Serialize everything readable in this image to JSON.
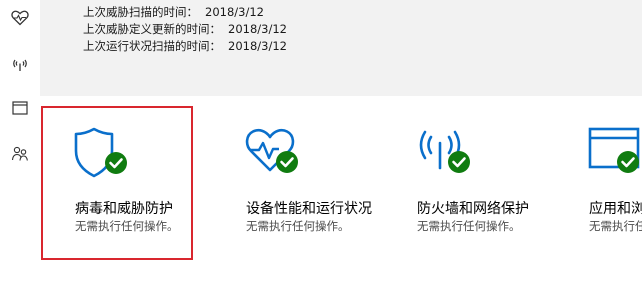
{
  "colors": {
    "accent_blue": "#0a6fcb",
    "check_green": "#107c10",
    "selection_red": "#d9262e"
  },
  "sidebar": {
    "icons": [
      {
        "name": "health-heart-icon"
      },
      {
        "name": "network-antenna-icon"
      },
      {
        "name": "app-browser-icon"
      },
      {
        "name": "family-icon"
      }
    ]
  },
  "status": {
    "lines": [
      {
        "label": "上次威胁扫描的时间：",
        "value": "2018/3/12"
      },
      {
        "label": "上次威胁定义更新的时间：",
        "value": "2018/3/12"
      },
      {
        "label": "上次运行状况扫描的时间：",
        "value": "2018/3/12"
      }
    ]
  },
  "tiles": [
    {
      "title": "病毒和威胁防护",
      "subtitle": "无需执行任何操作。",
      "icon": "shield-icon",
      "selected": true
    },
    {
      "title": "设备性能和运行状况",
      "subtitle": "无需执行任何操作。",
      "icon": "heart-pulse-icon"
    },
    {
      "title": "防火墙和网络保护",
      "subtitle": "无需执行任何操作。",
      "icon": "antenna-icon"
    },
    {
      "title": "应用和浏",
      "subtitle": "无需执行任",
      "icon": "browser-icon"
    }
  ]
}
